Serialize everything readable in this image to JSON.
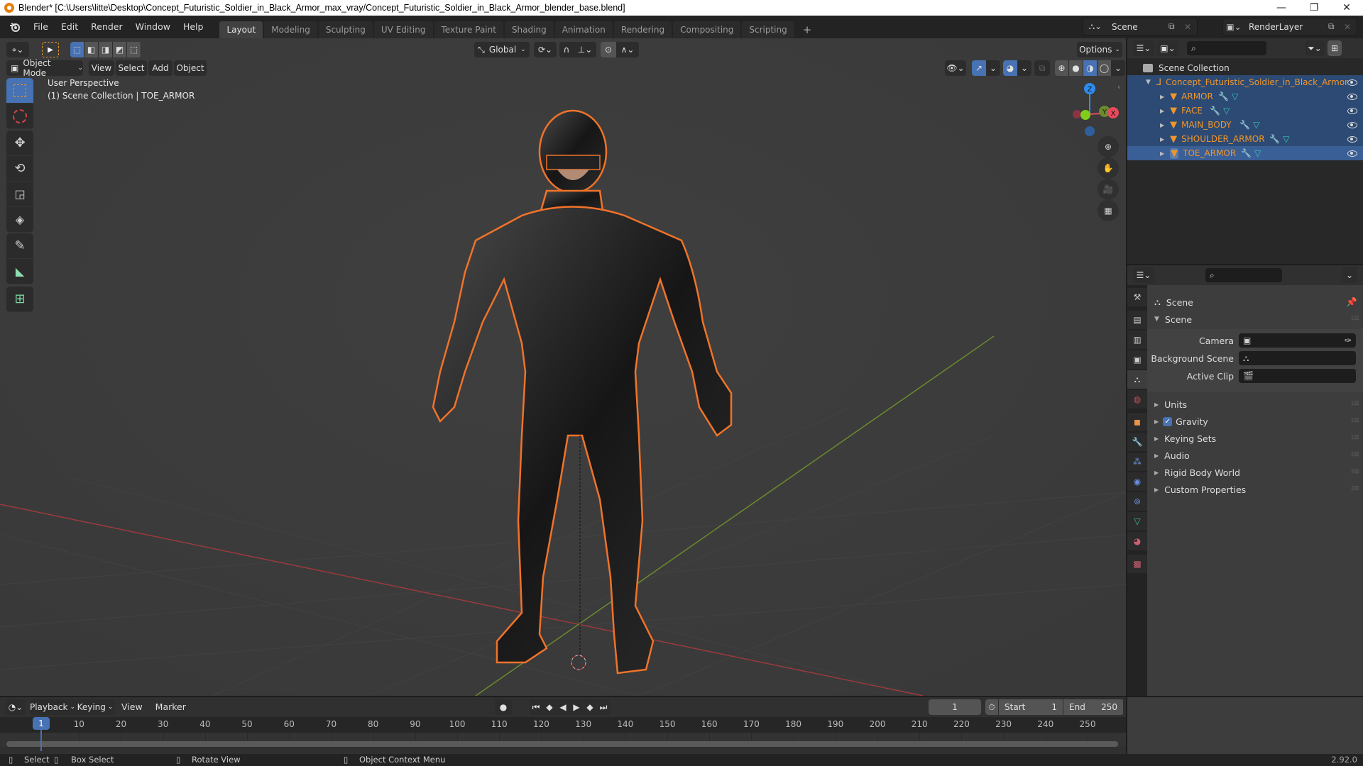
{
  "window": {
    "title": "Blender* [C:\\Users\\litte\\Desktop\\Concept_Futuristic_Soldier_in_Black_Armor_max_vray/Concept_Futuristic_Soldier_in_Black_Armor_blender_base.blend]",
    "minimize": "—",
    "maximize": "❐",
    "close": "✕"
  },
  "menu": [
    "File",
    "Edit",
    "Render",
    "Window",
    "Help"
  ],
  "workspaces": [
    {
      "label": "Layout",
      "active": true
    },
    {
      "label": "Modeling"
    },
    {
      "label": "Sculpting"
    },
    {
      "label": "UV Editing"
    },
    {
      "label": "Texture Paint"
    },
    {
      "label": "Shading"
    },
    {
      "label": "Animation"
    },
    {
      "label": "Rendering"
    },
    {
      "label": "Compositing"
    },
    {
      "label": "Scripting"
    }
  ],
  "add_workspace": "+",
  "scene_selector": {
    "value": "Scene"
  },
  "view_layer_selector": {
    "value": "RenderLayer"
  },
  "viewport": {
    "transform_orientation": "Global",
    "options_label": "Options",
    "mode": "Object Mode",
    "menus": [
      "View",
      "Select",
      "Add",
      "Object"
    ],
    "overlay_text_1": "User Perspective",
    "overlay_text_2": "(1) Scene Collection | TOE_ARMOR",
    "gizmo": {
      "z": "Z",
      "y": "Y",
      "x": "X"
    },
    "shading_mode": "solid-material-preview",
    "accent": "#4772b3",
    "selection_outline": "#f0732a"
  },
  "outliner": {
    "root": "Scene Collection",
    "collection": "Concept_Futuristic_Soldier_in_Black_Armor",
    "objects": [
      {
        "name": "ARMOR",
        "selected": true,
        "active": false
      },
      {
        "name": "FACE",
        "selected": true,
        "active": false
      },
      {
        "name": "MAIN_BODY",
        "selected": true,
        "active": false
      },
      {
        "name": "SHOULDER_ARMOR",
        "selected": true,
        "active": false
      },
      {
        "name": "TOE_ARMOR",
        "selected": true,
        "active": true
      }
    ]
  },
  "properties": {
    "context": "Scene",
    "panel": "Scene",
    "fields": [
      {
        "label": "Camera",
        "value": ""
      },
      {
        "label": "Background Scene",
        "value": ""
      },
      {
        "label": "Active Clip",
        "value": ""
      }
    ],
    "subpanels": [
      {
        "label": "Units",
        "checkbox": false
      },
      {
        "label": "Gravity",
        "checkbox": true,
        "checked": true
      },
      {
        "label": "Keying Sets",
        "checkbox": false
      },
      {
        "label": "Audio",
        "checkbox": false
      },
      {
        "label": "Rigid Body World",
        "checkbox": false
      },
      {
        "label": "Custom Properties",
        "checkbox": false
      }
    ],
    "tabs": [
      "tool",
      "render",
      "output",
      "view-layer",
      "scene",
      "world",
      "object",
      "modifiers",
      "particles",
      "physics",
      "constraints",
      "data",
      "material",
      "texture"
    ]
  },
  "timeline": {
    "menus": [
      "Playback",
      "Keying",
      "View",
      "Marker"
    ],
    "current_frame": "1",
    "start_label": "Start",
    "start": "1",
    "end_label": "End",
    "end": "250",
    "ticks": [
      "10",
      "20",
      "30",
      "40",
      "50",
      "60",
      "70",
      "80",
      "90",
      "100",
      "110",
      "120",
      "130",
      "140",
      "150",
      "160",
      "170",
      "180",
      "190",
      "200",
      "210",
      "220",
      "230",
      "240",
      "250"
    ],
    "playhead": "1"
  },
  "statusbar": {
    "items": [
      "Select",
      "Box Select",
      "Rotate View",
      "Object Context Menu"
    ],
    "version": "2.92.0"
  }
}
